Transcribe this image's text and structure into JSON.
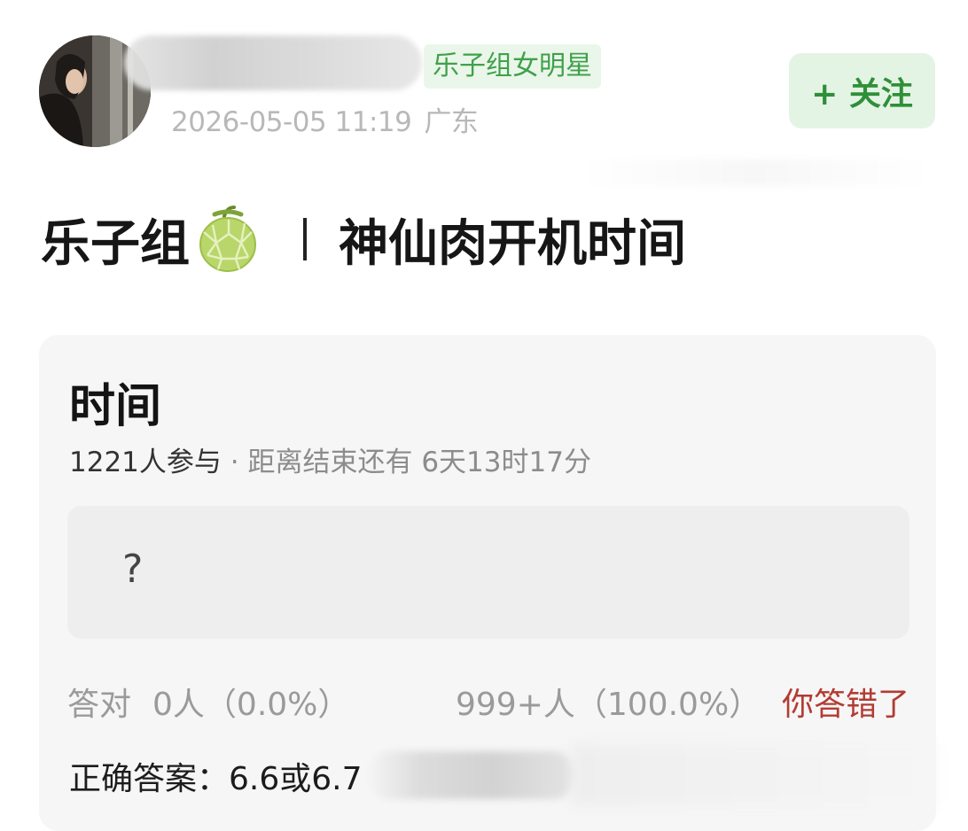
{
  "post": {
    "group_tag": "乐子组女明星",
    "timestamp": "2026-05-05 11:19",
    "location": "广东",
    "follow_label": "+ 关注",
    "title_prefix": "乐子组",
    "title_emoji": "melon-icon",
    "title_main": "神仙肉开机时间"
  },
  "quiz": {
    "title": "时间",
    "participants": "1221人参与",
    "separator": " · ",
    "countdown": "距离结束还有 6天13时17分",
    "question": "?",
    "correct_label": "答对",
    "correct_count": "0人（0.0%）",
    "wrong_count": "999+人（100.0%）",
    "status": "你答错了",
    "answer_label": "正确答案：",
    "answer_value": "6.6或6.7"
  },
  "colors": {
    "accent_green": "#3fa14a",
    "follow_bg": "#e3f4e4",
    "wrong_red": "#b23b33",
    "card_bg": "#f6f6f6"
  }
}
